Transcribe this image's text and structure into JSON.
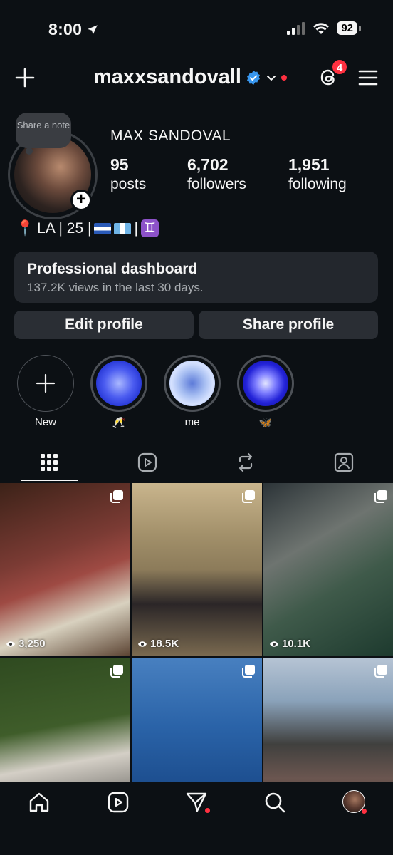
{
  "status_bar": {
    "time": "8:00",
    "battery": "92"
  },
  "header": {
    "username": "maxxsandovall",
    "notification_count": "4"
  },
  "profile": {
    "note_label": "Share a note",
    "full_name": "MAX SANDOVAL",
    "stats": [
      {
        "value": "95",
        "label": "posts"
      },
      {
        "value": "6,702",
        "label": "followers"
      },
      {
        "value": "1,951",
        "label": "following"
      }
    ],
    "bio": {
      "pin": "📍",
      "text": "LA | 25 |",
      "sep": "|",
      "zodiac": "♊"
    }
  },
  "dashboard": {
    "title": "Professional dashboard",
    "subtitle": "137.2K views in the last 30 days."
  },
  "buttons": {
    "edit": "Edit profile",
    "share": "Share profile"
  },
  "highlights": [
    {
      "label": "New"
    },
    {
      "label": "🥂"
    },
    {
      "label": "me"
    },
    {
      "label": "🦋"
    }
  ],
  "posts": [
    {
      "views": "3,250"
    },
    {
      "views": "18.5K"
    },
    {
      "views": "10.1K"
    }
  ],
  "colors": {
    "background": "#0c1014",
    "badge": "#ff3040",
    "verified": "#3897f0"
  }
}
